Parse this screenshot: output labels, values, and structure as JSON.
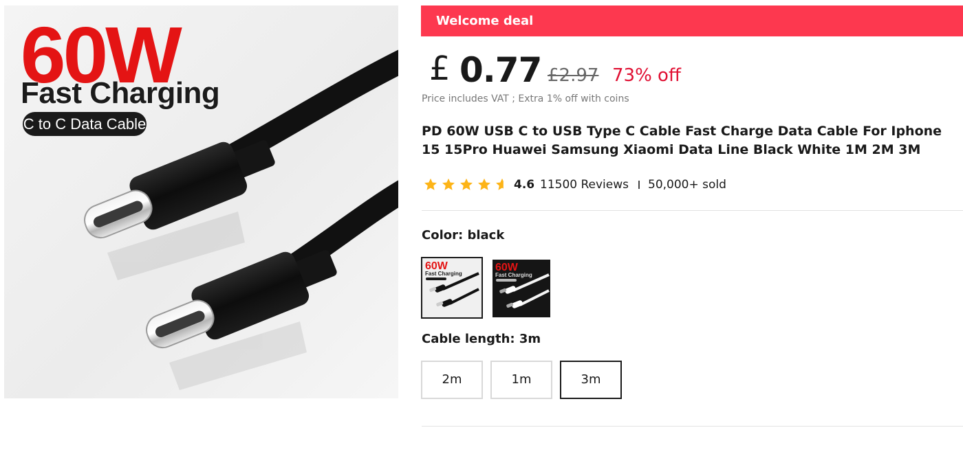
{
  "gallery": {
    "headline": "60W",
    "subheadline": "Fast Charging",
    "pill": "C to C Data Cable",
    "icon": "usb-c-cable-product-photo"
  },
  "deal": {
    "label": "Welcome deal",
    "color": "#fd384f"
  },
  "price": {
    "currency": "£",
    "current": "0.77",
    "original": "£2.97",
    "discount": "73% off",
    "note": "Price includes VAT ; Extra 1% off with coins"
  },
  "product": {
    "title": "PD 60W USB C to USB Type C Cable Fast Charge Data Cable For Iphone 15 15Pro Huawei Samsung Xiaomi Data Line Black White 1M 2M 3M"
  },
  "rating": {
    "value": "4.6",
    "stars": 4.6,
    "reviews": "11500 Reviews",
    "sold": "50,000+ sold",
    "star_color": "#fdb417"
  },
  "color_option": {
    "label": "Color: black",
    "swatches": [
      {
        "name": "black",
        "selected": true,
        "headline": "60W",
        "sub": "Fast Charging"
      },
      {
        "name": "white",
        "selected": false,
        "headline": "60W",
        "sub": "Fast Charging"
      }
    ]
  },
  "length_option": {
    "label": "Cable length: 3m",
    "options": [
      {
        "label": "2m",
        "selected": false
      },
      {
        "label": "1m",
        "selected": false
      },
      {
        "label": "3m",
        "selected": true
      }
    ]
  }
}
